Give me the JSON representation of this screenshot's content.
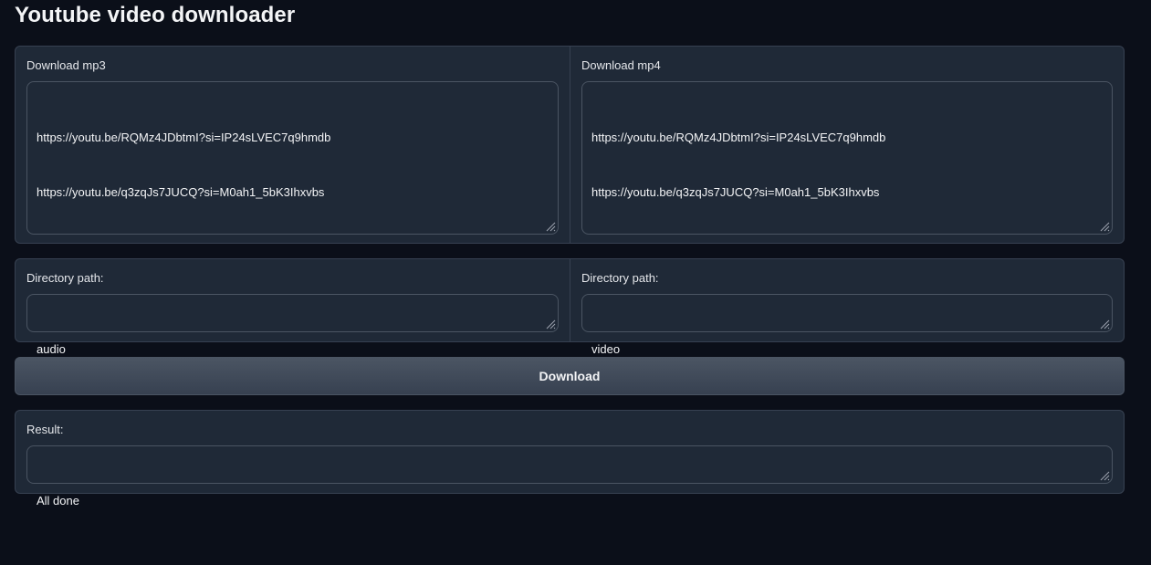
{
  "title": "Youtube video downloader",
  "links_panel": {
    "mp3": {
      "label": "Download mp3",
      "lines": [
        "https://youtu.be/RQMz4JDbtmI?si=IP24sLVEC7q9hmdb",
        "https://youtu.be/q3zqJs7JUCQ?si=M0ah1_5bK3Ihxvbs"
      ]
    },
    "mp4": {
      "label": "Download mp4",
      "lines": [
        "https://youtu.be/RQMz4JDbtmI?si=IP24sLVEC7q9hmdb",
        "https://youtu.be/q3zqJs7JUCQ?si=M0ah1_5bK3Ihxvbs"
      ]
    }
  },
  "paths_panel": {
    "audio": {
      "label": "Directory path:",
      "value": "audio"
    },
    "video": {
      "label": "Directory path:",
      "value": "video"
    }
  },
  "download_button": {
    "label": "Download"
  },
  "result": {
    "label": "Result:",
    "value": "All done"
  },
  "colors": {
    "background": "#0b0f19",
    "panel": "#1f2937",
    "border": "#374151",
    "text": "#e5e7eb"
  }
}
